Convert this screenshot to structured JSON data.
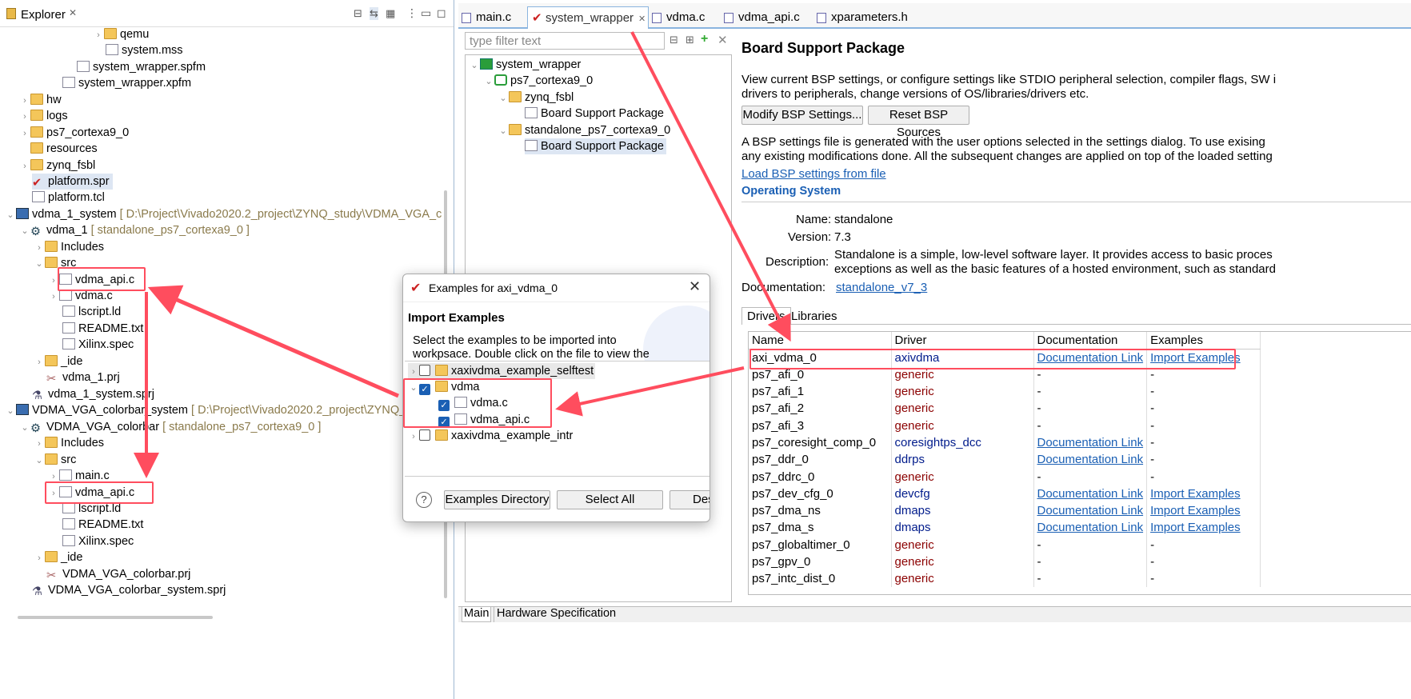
{
  "explorer": {
    "title": "Explorer",
    "tree": [
      {
        "label": "qemu",
        "deco": ""
      },
      {
        "label": "system.mss",
        "deco": ""
      },
      {
        "label": "system_wrapper.spfm",
        "deco": ""
      },
      {
        "label": "system_wrapper.xpfm",
        "deco": ""
      },
      {
        "label": "hw",
        "deco": ""
      },
      {
        "label": "logs",
        "deco": ""
      },
      {
        "label": "ps7_cortexa9_0",
        "deco": ""
      },
      {
        "label": "resources",
        "deco": ""
      },
      {
        "label": "zynq_fsbl",
        "deco": ""
      },
      {
        "label": "platform.spr",
        "deco": ""
      },
      {
        "label": "platform.tcl",
        "deco": ""
      },
      {
        "label": "vdma_1_system",
        "deco": "[ D:\\Project\\Vivado2020.2_project\\ZYNQ_study\\VDMA_VGA_c"
      },
      {
        "label": "vdma_1",
        "deco": "[ standalone_ps7_cortexa9_0 ]"
      },
      {
        "label": "Includes",
        "deco": ""
      },
      {
        "label": "src",
        "deco": ""
      },
      {
        "label": "vdma_api.c",
        "deco": ""
      },
      {
        "label": "vdma.c",
        "deco": ""
      },
      {
        "label": "lscript.ld",
        "deco": ""
      },
      {
        "label": "README.txt",
        "deco": ""
      },
      {
        "label": "Xilinx.spec",
        "deco": ""
      },
      {
        "label": "_ide",
        "deco": ""
      },
      {
        "label": "vdma_1.prj",
        "deco": ""
      },
      {
        "label": "vdma_1_system.sprj",
        "deco": ""
      },
      {
        "label": "VDMA_VGA_colorbar_system",
        "deco": "[ D:\\Project\\Vivado2020.2_project\\ZYNQ_"
      },
      {
        "label": "VDMA_VGA_colorbar",
        "deco": "[ standalone_ps7_cortexa9_0 ]"
      },
      {
        "label": "Includes",
        "deco": ""
      },
      {
        "label": "src",
        "deco": ""
      },
      {
        "label": "main.c",
        "deco": ""
      },
      {
        "label": "vdma_api.c",
        "deco": ""
      },
      {
        "label": "lscript.ld",
        "deco": ""
      },
      {
        "label": "README.txt",
        "deco": ""
      },
      {
        "label": "Xilinx.spec",
        "deco": ""
      },
      {
        "label": "_ide",
        "deco": ""
      },
      {
        "label": "VDMA_VGA_colorbar.prj",
        "deco": ""
      },
      {
        "label": "VDMA_VGA_colorbar_system.sprj",
        "deco": ""
      }
    ]
  },
  "editor": {
    "tabs": [
      "main.c",
      "system_wrapper",
      "vdma.c",
      "vdma_api.c",
      "xparameters.h"
    ],
    "filter_placeholder": "type filter text",
    "tree": [
      "system_wrapper",
      "ps7_cortexa9_0",
      "zynq_fsbl",
      "Board Support Package",
      "standalone_ps7_cortexa9_0",
      "Board Support Package"
    ],
    "bsp": {
      "title": "Board Support Package",
      "desc1": "View current BSP settings, or configure settings like STDIO peripheral selection, compiler flags, SW i",
      "desc2": "drivers to peripherals, change versions of OS/libraries/drivers etc.",
      "modify_btn": "Modify BSP Settings...",
      "reset_btn": "Reset BSP Sources",
      "info1": "A BSP settings file is generated with the user options selected in the settings dialog. To use exising",
      "info2": "any existing modifications done. All the subsequent changes are applied on top of the loaded setting",
      "load_link": "Load BSP settings from file",
      "os_title": "Operating System",
      "name_label": "Name:",
      "name_value": "standalone",
      "version_label": "Version:",
      "version_value": "7.3",
      "description_label": "Description:",
      "description_value1": "Standalone is a simple, low-level software layer. It provides access to basic proces",
      "description_value2": "exceptions as well as the basic features of a hosted environment, such as standard",
      "documentation_label": "Documentation:",
      "documentation_value": "standalone_v7_3",
      "drv_tabs": [
        "Drivers",
        "Libraries"
      ],
      "table_headers": [
        "Name",
        "Driver",
        "Documentation",
        "Examples"
      ],
      "rows": [
        [
          "axi_vdma_0",
          "axivdma",
          "Documentation Link",
          "Import Examples"
        ],
        [
          "ps7_afi_0",
          "generic",
          "-",
          "-"
        ],
        [
          "ps7_afi_1",
          "generic",
          "-",
          "-"
        ],
        [
          "ps7_afi_2",
          "generic",
          "-",
          "-"
        ],
        [
          "ps7_afi_3",
          "generic",
          "-",
          "-"
        ],
        [
          "ps7_coresight_comp_0",
          "coresightps_dcc",
          "Documentation Link",
          "-"
        ],
        [
          "ps7_ddr_0",
          "ddrps",
          "Documentation Link",
          "-"
        ],
        [
          "ps7_ddrc_0",
          "generic",
          "-",
          "-"
        ],
        [
          "ps7_dev_cfg_0",
          "devcfg",
          "Documentation Link",
          "Import Examples"
        ],
        [
          "ps7_dma_ns",
          "dmaps",
          "Documentation Link",
          "Import Examples"
        ],
        [
          "ps7_dma_s",
          "dmaps",
          "Documentation Link",
          "Import Examples"
        ],
        [
          "ps7_globaltimer_0",
          "generic",
          "-",
          "-"
        ],
        [
          "ps7_gpv_0",
          "generic",
          "-",
          "-"
        ],
        [
          "ps7_intc_dist_0",
          "generic",
          "-",
          "-"
        ]
      ]
    },
    "bottom_tabs": [
      "Main",
      "Hardware Specification"
    ]
  },
  "dialog": {
    "title": "Examples for axi_vdma_0",
    "heading": "Import Examples",
    "desc1": "Select the examples to be imported into",
    "desc2": "workpsace. Double click on the file to view the",
    "items": [
      {
        "label": "xaxivdma_example_selftest",
        "checked": false
      },
      {
        "label": "vdma",
        "checked": true
      },
      {
        "label": "vdma.c",
        "checked": true
      },
      {
        "label": "vdma_api.c",
        "checked": true
      },
      {
        "label": "xaxivdma_example_intr",
        "checked": false
      }
    ],
    "help": "?",
    "btn_dir": "Examples Directory",
    "btn_all": "Select All",
    "btn_des": "Des"
  }
}
